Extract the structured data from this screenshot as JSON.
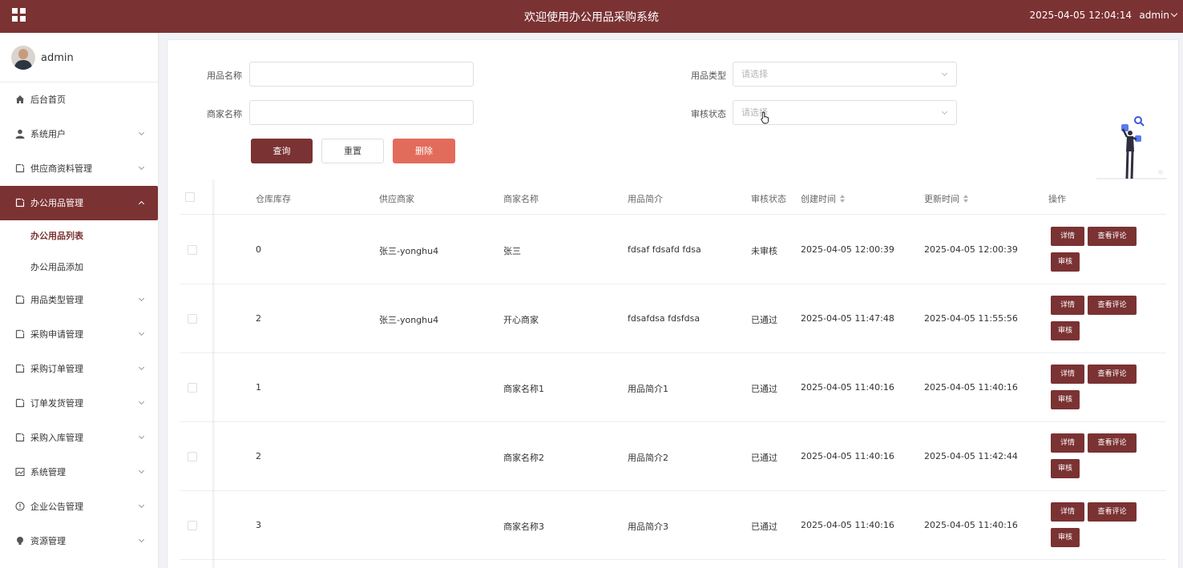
{
  "header": {
    "title": "欢迎使用办公用品采购系统",
    "datetime": "2025-04-05 12:04:14",
    "user": "admin"
  },
  "sidebar": {
    "username": "admin",
    "items": [
      {
        "label": "后台首页",
        "icon": "home-icon"
      },
      {
        "label": "系统用户",
        "icon": "user-icon"
      },
      {
        "label": "供应商资料管理",
        "icon": "doc-icon"
      },
      {
        "label": "办公用品管理",
        "icon": "doc-icon",
        "active": true
      },
      {
        "label": "用品类型管理",
        "icon": "doc-icon"
      },
      {
        "label": "采购申请管理",
        "icon": "doc-icon"
      },
      {
        "label": "采购订单管理",
        "icon": "doc-icon"
      },
      {
        "label": "订单发货管理",
        "icon": "doc-icon"
      },
      {
        "label": "采购入库管理",
        "icon": "doc-icon"
      },
      {
        "label": "系统管理",
        "icon": "picture-icon"
      },
      {
        "label": "企业公告管理",
        "icon": "info-icon"
      },
      {
        "label": "资源管理",
        "icon": "bulb-icon"
      }
    ],
    "subitems": [
      "办公用品列表",
      "办公用品添加"
    ]
  },
  "search": {
    "name_label": "用品名称",
    "name_value": "",
    "type_label": "用品类型",
    "type_placeholder": "请选择",
    "merchant_label": "商家名称",
    "merchant_value": "",
    "status_label": "审核状态",
    "status_placeholder": "请选择",
    "query_label": "查询",
    "reset_label": "重置",
    "delete_label": "删除"
  },
  "table": {
    "columns": [
      "仓库库存",
      "供应商家",
      "商家名称",
      "用品简介",
      "审核状态",
      "创建时间",
      "更新时间",
      "操作"
    ],
    "rows": [
      {
        "stock": "0",
        "supplier": "张三-yonghu4",
        "merchant": "张三",
        "intro": "fdsaf fdsafd fdsa",
        "status": "未审核",
        "created": "2025-04-05 12:00:39",
        "updated": "2025-04-05 12:00:39"
      },
      {
        "stock": "2",
        "supplier": "张三-yonghu4",
        "merchant": "开心商家",
        "intro": "fdsafdsa fdsfdsa",
        "status": "已通过",
        "created": "2025-04-05 11:47:48",
        "updated": "2025-04-05 11:55:56"
      },
      {
        "stock": "1",
        "supplier": "",
        "merchant": "商家名称1",
        "intro": "用品简介1",
        "status": "已通过",
        "created": "2025-04-05 11:40:16",
        "updated": "2025-04-05 11:40:16"
      },
      {
        "stock": "2",
        "supplier": "",
        "merchant": "商家名称2",
        "intro": "用品简介2",
        "status": "已通过",
        "created": "2025-04-05 11:40:16",
        "updated": "2025-04-05 11:42:44"
      },
      {
        "stock": "3",
        "supplier": "",
        "merchant": "商家名称3",
        "intro": "用品简介3",
        "status": "已通过",
        "created": "2025-04-05 11:40:16",
        "updated": "2025-04-05 11:40:16"
      }
    ],
    "actions": {
      "detail": "详情",
      "review": "查看评论",
      "audit": "审核"
    }
  },
  "colors": {
    "primary": "#7b3233",
    "danger": "#e36b5b"
  }
}
